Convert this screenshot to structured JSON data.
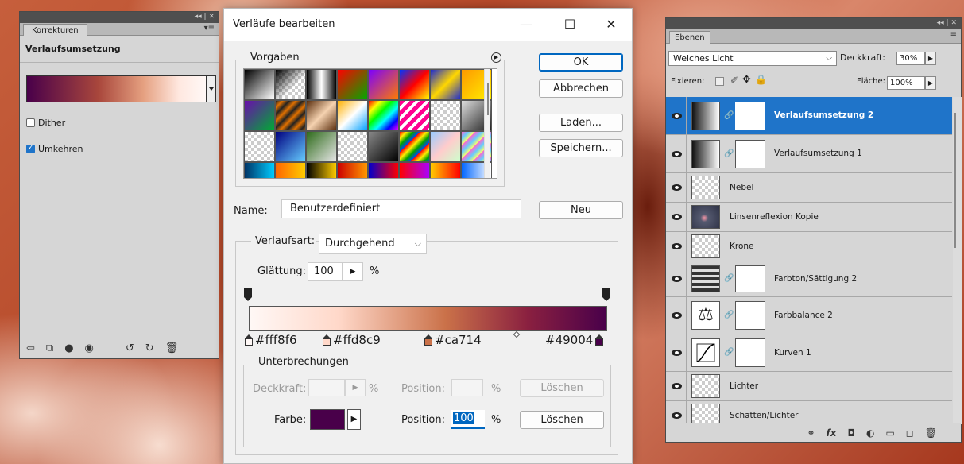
{
  "korrekturen": {
    "collapse_glyph": "◂◂ | ✕",
    "tab": "Korrekturen",
    "menu_glyph": "▾≡",
    "title": "Verlaufsumsetzung",
    "dither_label": "Dither",
    "dither_checked": false,
    "umkehren_label": "Umkehren",
    "umkehren_checked": true,
    "footer_icons": [
      "clip-icon",
      "view-previous-icon",
      "visibility-icon",
      "eye-icon",
      "reset-view-icon",
      "reset-icon",
      "trash-icon"
    ]
  },
  "dialog": {
    "title": "Verläufe bearbeiten",
    "minimize_glyph": "—",
    "maximize_glyph": "☐",
    "close_glyph": "✕",
    "vorgaben_label": "Vorgaben",
    "vorgaben_menu_glyph": "▶",
    "buttons": {
      "ok": "OK",
      "cancel": "Abbrechen",
      "load": "Laden...",
      "save": "Speichern...",
      "new": "Neu"
    },
    "name_label": "Name:",
    "name_value": "Benutzerdefiniert",
    "gradient_type_label": "Verlaufsart:",
    "gradient_type_value": "Durchgehend",
    "smoothness_label": "Glättung:",
    "smoothness_value": "100",
    "smoothness_unit": "%",
    "stops": [
      {
        "color": "#fff8f6",
        "label": "#fff8f6"
      },
      {
        "color": "#ffd8c9",
        "label": "#ffd8c9"
      },
      {
        "color": "#ca714",
        "label": "#ca714"
      },
      {
        "color": "#49004",
        "label": "#49004"
      }
    ],
    "stops_group_label": "Unterbrechungen",
    "opacity_label": "Deckkraft:",
    "opacity_unit": "%",
    "position_label": "Position:",
    "position_unit": "%",
    "delete_label": "Löschen",
    "color_label": "Farbe:",
    "color_value": "#49004a",
    "color_position_label": "Position:",
    "color_position_value": "100",
    "color_position_unit": "%",
    "color_delete_label": "Löschen"
  },
  "ebenen": {
    "collapse_glyph": "◂◂ | ✕",
    "tab": "Ebenen",
    "menu_glyph": "≡",
    "blend_mode": "Weiches Licht",
    "opacity_label": "Deckkraft:",
    "opacity_value": "30%",
    "lock_label": "Fixieren:",
    "fill_label": "Fläche:",
    "fill_value": "100%",
    "layers": [
      {
        "name": "Verlaufsumsetzung 2",
        "selected": true,
        "thumb": "gradient-map",
        "mask": true
      },
      {
        "name": "Verlaufsumsetzung 1",
        "selected": false,
        "thumb": "gradient-map",
        "mask": true
      },
      {
        "name": "Nebel",
        "selected": false,
        "thumb": "transparent",
        "mask": false
      },
      {
        "name": "Linsenreflexion Kopie",
        "selected": false,
        "thumb": "flare",
        "mask": false
      },
      {
        "name": "Krone",
        "selected": false,
        "thumb": "transparent",
        "mask": false
      },
      {
        "name": "Farbton/Sättigung 2",
        "selected": false,
        "thumb": "hue-saturation",
        "mask": true
      },
      {
        "name": "Farbbalance 2",
        "selected": false,
        "thumb": "color-balance",
        "mask": true
      },
      {
        "name": "Kurven 1",
        "selected": false,
        "thumb": "curves",
        "mask": true
      },
      {
        "name": "Lichter",
        "selected": false,
        "thumb": "transparent",
        "mask": false
      },
      {
        "name": "Schatten/Lichter",
        "selected": false,
        "thumb": "transparent",
        "mask": false
      }
    ],
    "footer_icons": [
      "link-icon",
      "fx-icon",
      "mask-icon",
      "adjustment-icon",
      "folder-icon",
      "new-layer-icon",
      "trash-icon"
    ],
    "footer_glyphs": [
      "⚭",
      "fx",
      "◘",
      "◐",
      "▭",
      "◻",
      "🗑"
    ]
  }
}
